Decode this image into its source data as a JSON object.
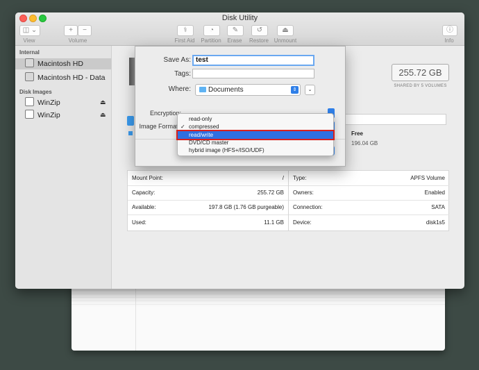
{
  "window": {
    "title": "Disk Utility"
  },
  "toolbar": {
    "view_label": "View",
    "volume_label": "Volume",
    "add_glyph": "+",
    "remove_glyph": "−",
    "first_aid_label": "First Aid",
    "partition_label": "Partition",
    "erase_label": "Erase",
    "restore_label": "Restore",
    "unmount_label": "Unmount",
    "info_label": "Info"
  },
  "sidebar": {
    "internal_header": "Internal",
    "disk_images_header": "Disk Images",
    "internal_items": [
      {
        "label": "Macintosh HD",
        "selected": true
      },
      {
        "label": "Macintosh HD - Data",
        "selected": false
      }
    ],
    "image_items": [
      {
        "label": "WinZip",
        "eject": "⏏"
      },
      {
        "label": "WinZip",
        "eject": "⏏"
      }
    ]
  },
  "volume": {
    "capacity_display": "255.72 GB",
    "shared_text": "SHARED BY 5 VOLUMES",
    "free_label": "Free",
    "free_value": "196.04 GB"
  },
  "info": {
    "left": [
      {
        "key": "Mount Point:",
        "value": "/"
      },
      {
        "key": "Capacity:",
        "value": "255.72 GB"
      },
      {
        "key": "Available:",
        "value": "197.8 GB (1.76 GB purgeable)"
      },
      {
        "key": "Used:",
        "value": "11.1 GB"
      }
    ],
    "right": [
      {
        "key": "Type:",
        "value": "APFS Volume"
      },
      {
        "key": "Owners:",
        "value": "Enabled"
      },
      {
        "key": "Connection:",
        "value": "SATA"
      },
      {
        "key": "Device:",
        "value": "disk1s5"
      }
    ]
  },
  "dialog": {
    "save_as_label": "Save As:",
    "save_as_value": "test",
    "tags_label": "Tags:",
    "tags_value": "",
    "where_label": "Where:",
    "where_value": "Documents",
    "encryption_label": "Encryption:",
    "image_format_label": "Image Format:"
  },
  "format_menu": {
    "items": [
      "read-only",
      "compressed",
      "read/write",
      "DVD/CD master",
      "hybrid image (HFS+/ISO/UDF)"
    ],
    "checked_index": 1,
    "highlighted_index": 2,
    "check_glyph": "✓"
  },
  "colors": {
    "accent": "#2f6fe0",
    "highlight_outline": "#d9201b"
  }
}
